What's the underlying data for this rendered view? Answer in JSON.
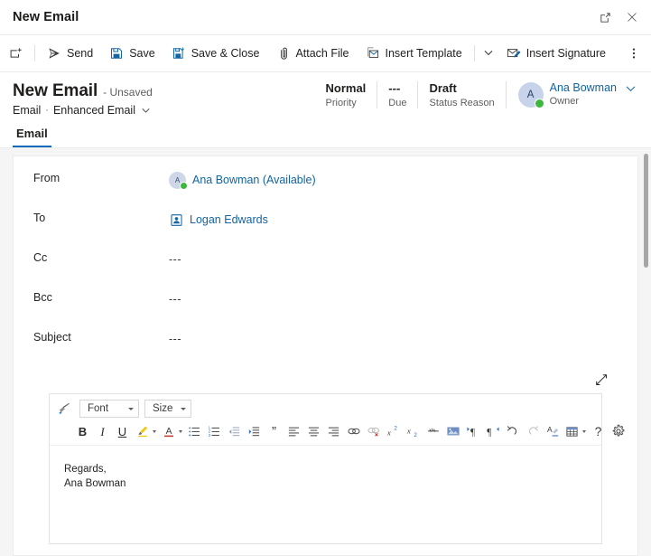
{
  "window": {
    "title": "New Email",
    "popout_tooltip": "Pop out",
    "close_tooltip": "Close"
  },
  "commandbar": {
    "new_label": "",
    "items": [
      {
        "label": "Send",
        "icon": "send-icon"
      },
      {
        "label": "Save",
        "icon": "save-icon"
      },
      {
        "label": "Save & Close",
        "icon": "save-close-icon"
      },
      {
        "label": "Attach File",
        "icon": "attach-file-icon"
      },
      {
        "label": "Insert Template",
        "icon": "insert-template-icon"
      },
      {
        "label": "Insert Signature",
        "icon": "insert-signature-icon"
      }
    ],
    "overflow_label": "More commands"
  },
  "record_header": {
    "title": "New Email",
    "unsaved": "- Unsaved",
    "entity": "Email",
    "separator": "·",
    "form_name": "Enhanced Email",
    "stats": [
      {
        "value": "Normal",
        "label": "Priority"
      },
      {
        "value": "---",
        "label": "Due"
      },
      {
        "value": "Draft",
        "label": "Status Reason"
      }
    ],
    "owner": {
      "initial": "A",
      "name": "Ana Bowman",
      "role": "Owner",
      "presence": "available"
    }
  },
  "tabs": [
    {
      "label": "Email",
      "selected": true
    }
  ],
  "form": {
    "rows": [
      {
        "label": "From",
        "type": "person",
        "initial": "A",
        "value": "Ana Bowman (Available)",
        "presence": "available"
      },
      {
        "label": "To",
        "type": "contact",
        "value": "Logan Edwards"
      },
      {
        "label": "Cc",
        "type": "empty",
        "value": "---"
      },
      {
        "label": "Bcc",
        "type": "empty",
        "value": "---"
      },
      {
        "label": "Subject",
        "type": "empty",
        "value": "---"
      }
    ]
  },
  "editor": {
    "expand_label": "Expand",
    "font_select": {
      "value": "Font"
    },
    "size_select": {
      "value": "Size"
    },
    "toolbar_row1": [
      {
        "name": "format-painter-icon",
        "label": "Format Painter"
      }
    ],
    "toolbar_row2": [
      {
        "name": "bold-icon",
        "label": "Bold"
      },
      {
        "name": "italic-icon",
        "label": "Italic"
      },
      {
        "name": "underline-icon",
        "label": "Underline"
      },
      {
        "name": "highlight-color-icon",
        "label": "Highlight"
      },
      {
        "name": "font-color-icon",
        "label": "Font Color"
      },
      {
        "name": "bulleted-list-icon",
        "label": "Bulleted List"
      },
      {
        "name": "numbered-list-icon",
        "label": "Numbered List"
      },
      {
        "name": "decrease-indent-icon",
        "label": "Decrease Indent"
      },
      {
        "name": "increase-indent-icon",
        "label": "Increase Indent"
      },
      {
        "name": "blockquote-icon",
        "label": "Block Quote"
      },
      {
        "name": "align-left-icon",
        "label": "Align Left"
      },
      {
        "name": "align-center-icon",
        "label": "Align Center"
      },
      {
        "name": "align-right-icon",
        "label": "Align Right"
      },
      {
        "name": "insert-link-icon",
        "label": "Insert Link"
      },
      {
        "name": "remove-link-icon",
        "label": "Remove Link"
      },
      {
        "name": "superscript-icon",
        "label": "Superscript"
      },
      {
        "name": "subscript-icon",
        "label": "Subscript"
      },
      {
        "name": "strikethrough-icon",
        "label": "Strikethrough"
      },
      {
        "name": "insert-image-icon",
        "label": "Insert Image"
      },
      {
        "name": "ltr-direction-icon",
        "label": "Left to Right"
      },
      {
        "name": "rtl-direction-icon",
        "label": "Right to Left"
      },
      {
        "name": "undo-icon",
        "label": "Undo"
      },
      {
        "name": "redo-icon",
        "label": "Redo"
      },
      {
        "name": "clear-formatting-icon",
        "label": "Clear Formatting"
      },
      {
        "name": "table-icon",
        "label": "Table"
      },
      {
        "name": "help-icon",
        "label": "Help"
      },
      {
        "name": "settings-icon",
        "label": "Settings"
      }
    ],
    "body_lines": [
      "Regards,",
      "Ana Bowman"
    ],
    "body_line1": "Regards,",
    "body_line2": "Ana Bowman"
  },
  "colors": {
    "accent": "#0f6cbd",
    "link": "#1264a3",
    "presence_available": "#3db63d",
    "avatar_bg": "#c7d3ea",
    "canvas": "#f5f5f5",
    "highlight_yellow": "#f2c811",
    "font_color_red": "#c2362b"
  }
}
